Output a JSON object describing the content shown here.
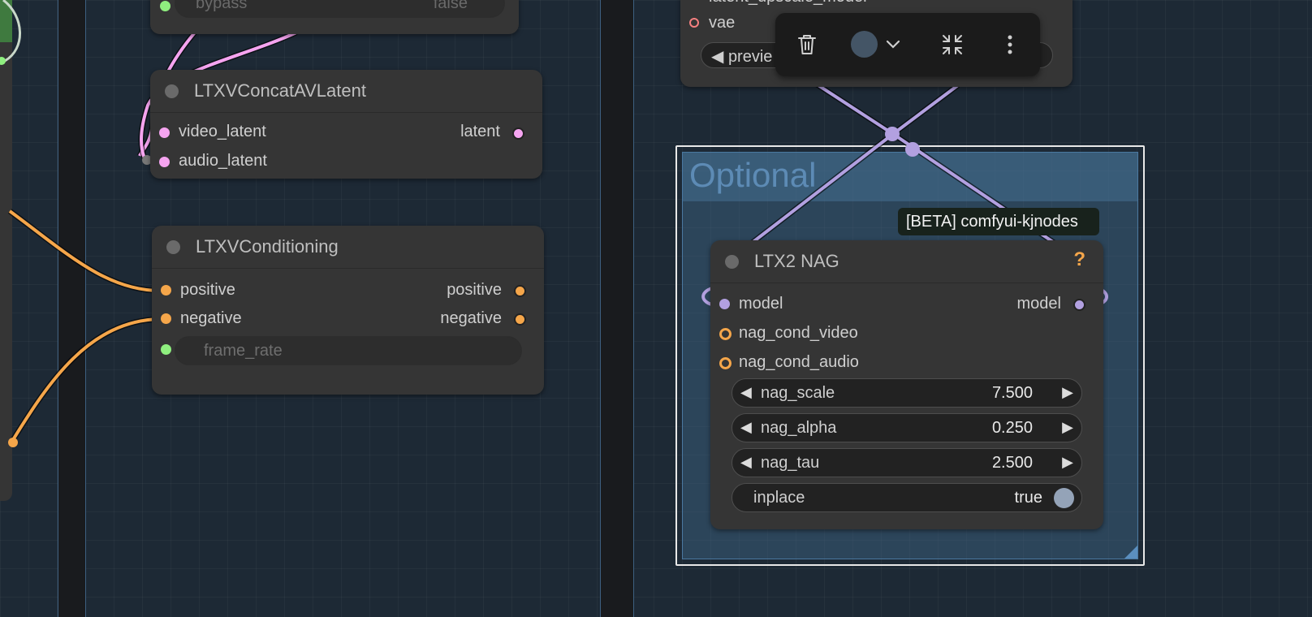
{
  "nodes": {
    "top_bypass": {
      "widget_label": "bypass",
      "widget_value": "false"
    },
    "concat": {
      "title": "LTXVConcatAVLatent",
      "inputs": [
        "video_latent",
        "audio_latent"
      ],
      "output": "latent"
    },
    "conditioning": {
      "title": "LTXVConditioning",
      "inputs": [
        "positive",
        "negative"
      ],
      "outputs": [
        "positive",
        "negative"
      ],
      "widget_label": "frame_rate"
    },
    "upscale": {
      "slot_top": "latent_upscale_model",
      "vae_label": "vae",
      "button_label": "◀ previe"
    },
    "nag": {
      "title": "LTX2 NAG",
      "help": "?",
      "input": "model",
      "output": "model",
      "cond_inputs": [
        "nag_cond_video",
        "nag_cond_audio"
      ],
      "widgets": [
        {
          "label": "nag_scale",
          "value": "7.500"
        },
        {
          "label": "nag_alpha",
          "value": "0.250"
        },
        {
          "label": "nag_tau",
          "value": "2.500"
        }
      ],
      "toggle": {
        "label": "inplace",
        "value": "true"
      }
    }
  },
  "group": {
    "title": "Optional"
  },
  "tooltip": "[BETA] comfyui-kjnodes",
  "toolbar": {
    "color_value": "#445566"
  },
  "colors": {
    "canvas": "#1d2935",
    "node": "#353535",
    "latent_pink": "#f5a4f0",
    "conditioning_orange": "#f5a64a",
    "model_lavender": "#b2a0e0",
    "int_green": "#8fef7f",
    "vae_red": "#f58080"
  },
  "icons": [
    "trash-icon",
    "color-circle-icon",
    "chevron-down-icon",
    "collapse-icon",
    "more-vertical-icon"
  ]
}
